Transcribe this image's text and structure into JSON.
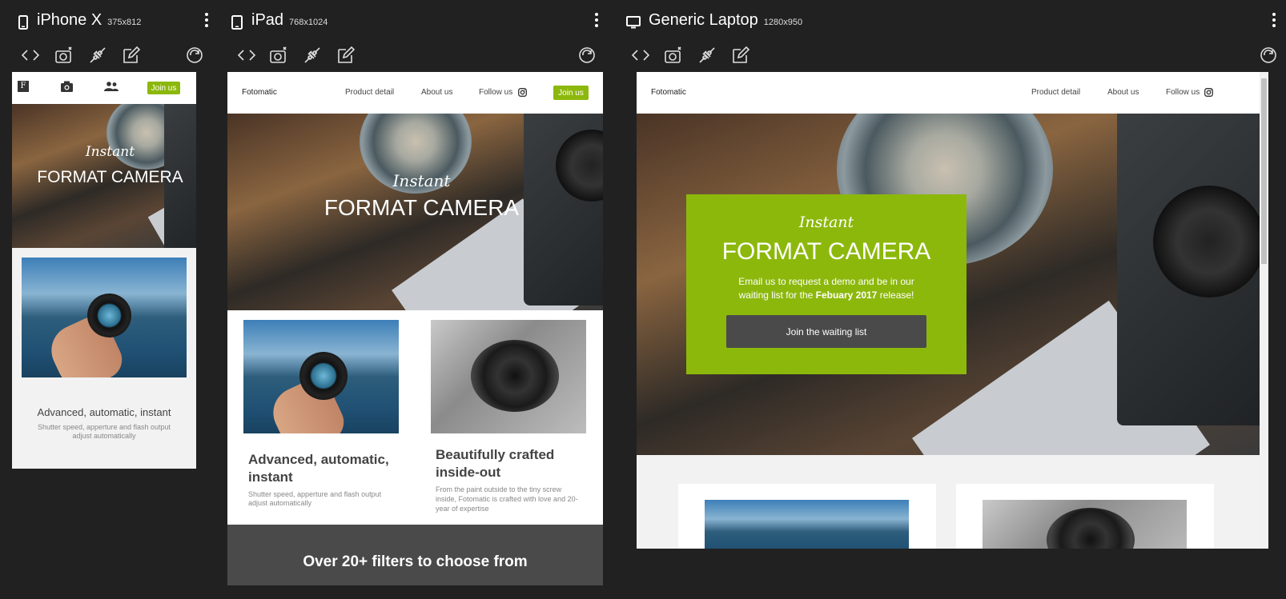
{
  "devices": {
    "iphone": {
      "name": "iPhone X",
      "size": "375x812"
    },
    "ipad": {
      "name": "iPad",
      "size": "768x1024"
    },
    "laptop": {
      "name": "Generic Laptop",
      "size": "1280x950"
    }
  },
  "site": {
    "brand": "Fotomatic",
    "nav": {
      "product": "Product detail",
      "about": "About us",
      "follow": "Follow us",
      "join": "Join us"
    },
    "hero": {
      "script": "Instant",
      "title": "FORMAT CAMERA"
    },
    "cta": {
      "text_before": "Email us to request a demo and be in our waiting list for the ",
      "text_bold": "Febuary 2017",
      "text_after": " release!",
      "button": "Join the waiting list"
    },
    "features": [
      {
        "title": "Advanced, automatic, instant",
        "desc": "Shutter speed, apperture and flash output adjust automatically"
      },
      {
        "title": "Beautifully crafted inside-out",
        "desc": "From the paint outside to the tiny screw inside, Fotomatic is crafted with love and 20-year of expertise"
      }
    ],
    "filters_heading": "Over 20+ filters to choose from"
  },
  "colors": {
    "accent": "#8cb80c",
    "background": "#212121",
    "dark_band": "#4a4a4a"
  },
  "icons": [
    "phone-icon",
    "tablet-icon",
    "monitor-icon",
    "more-vert-icon",
    "code-icon",
    "camera-icon",
    "plug-icon",
    "edit-icon",
    "rotate-icon",
    "instagram-icon",
    "f-logo-icon",
    "people-icon"
  ]
}
